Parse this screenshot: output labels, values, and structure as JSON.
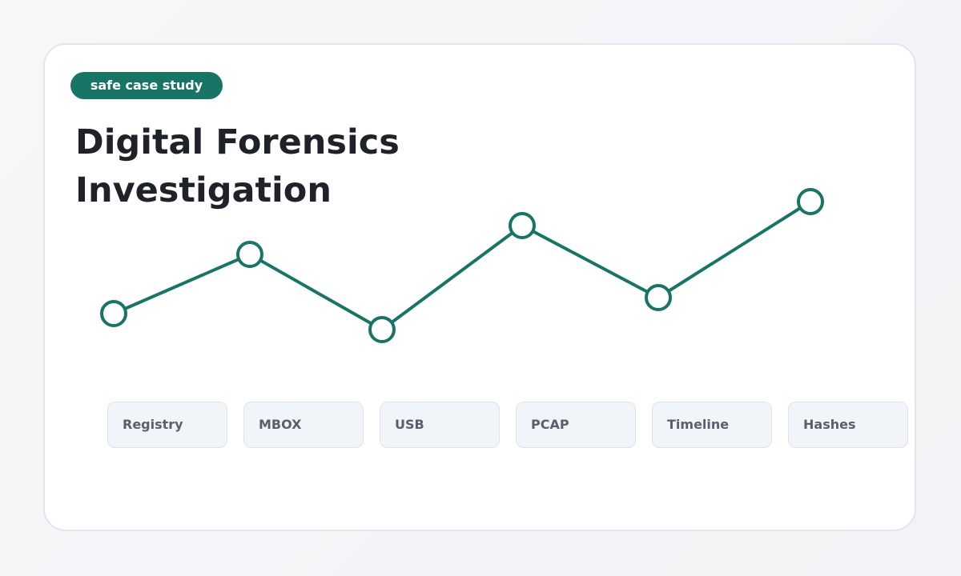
{
  "badge": {
    "label": "safe case study"
  },
  "title": {
    "line1": "Digital Forensics",
    "line2": "Investigation"
  },
  "chips": [
    {
      "label": "Registry"
    },
    {
      "label": "MBOX"
    },
    {
      "label": "USB"
    },
    {
      "label": "PCAP"
    },
    {
      "label": "Timeline"
    },
    {
      "label": "Hashes"
    }
  ],
  "colors": {
    "accent": "#187566",
    "title": "#1f2229",
    "chip_bg": "#f1f4f8",
    "chip_text": "#59606d"
  }
}
